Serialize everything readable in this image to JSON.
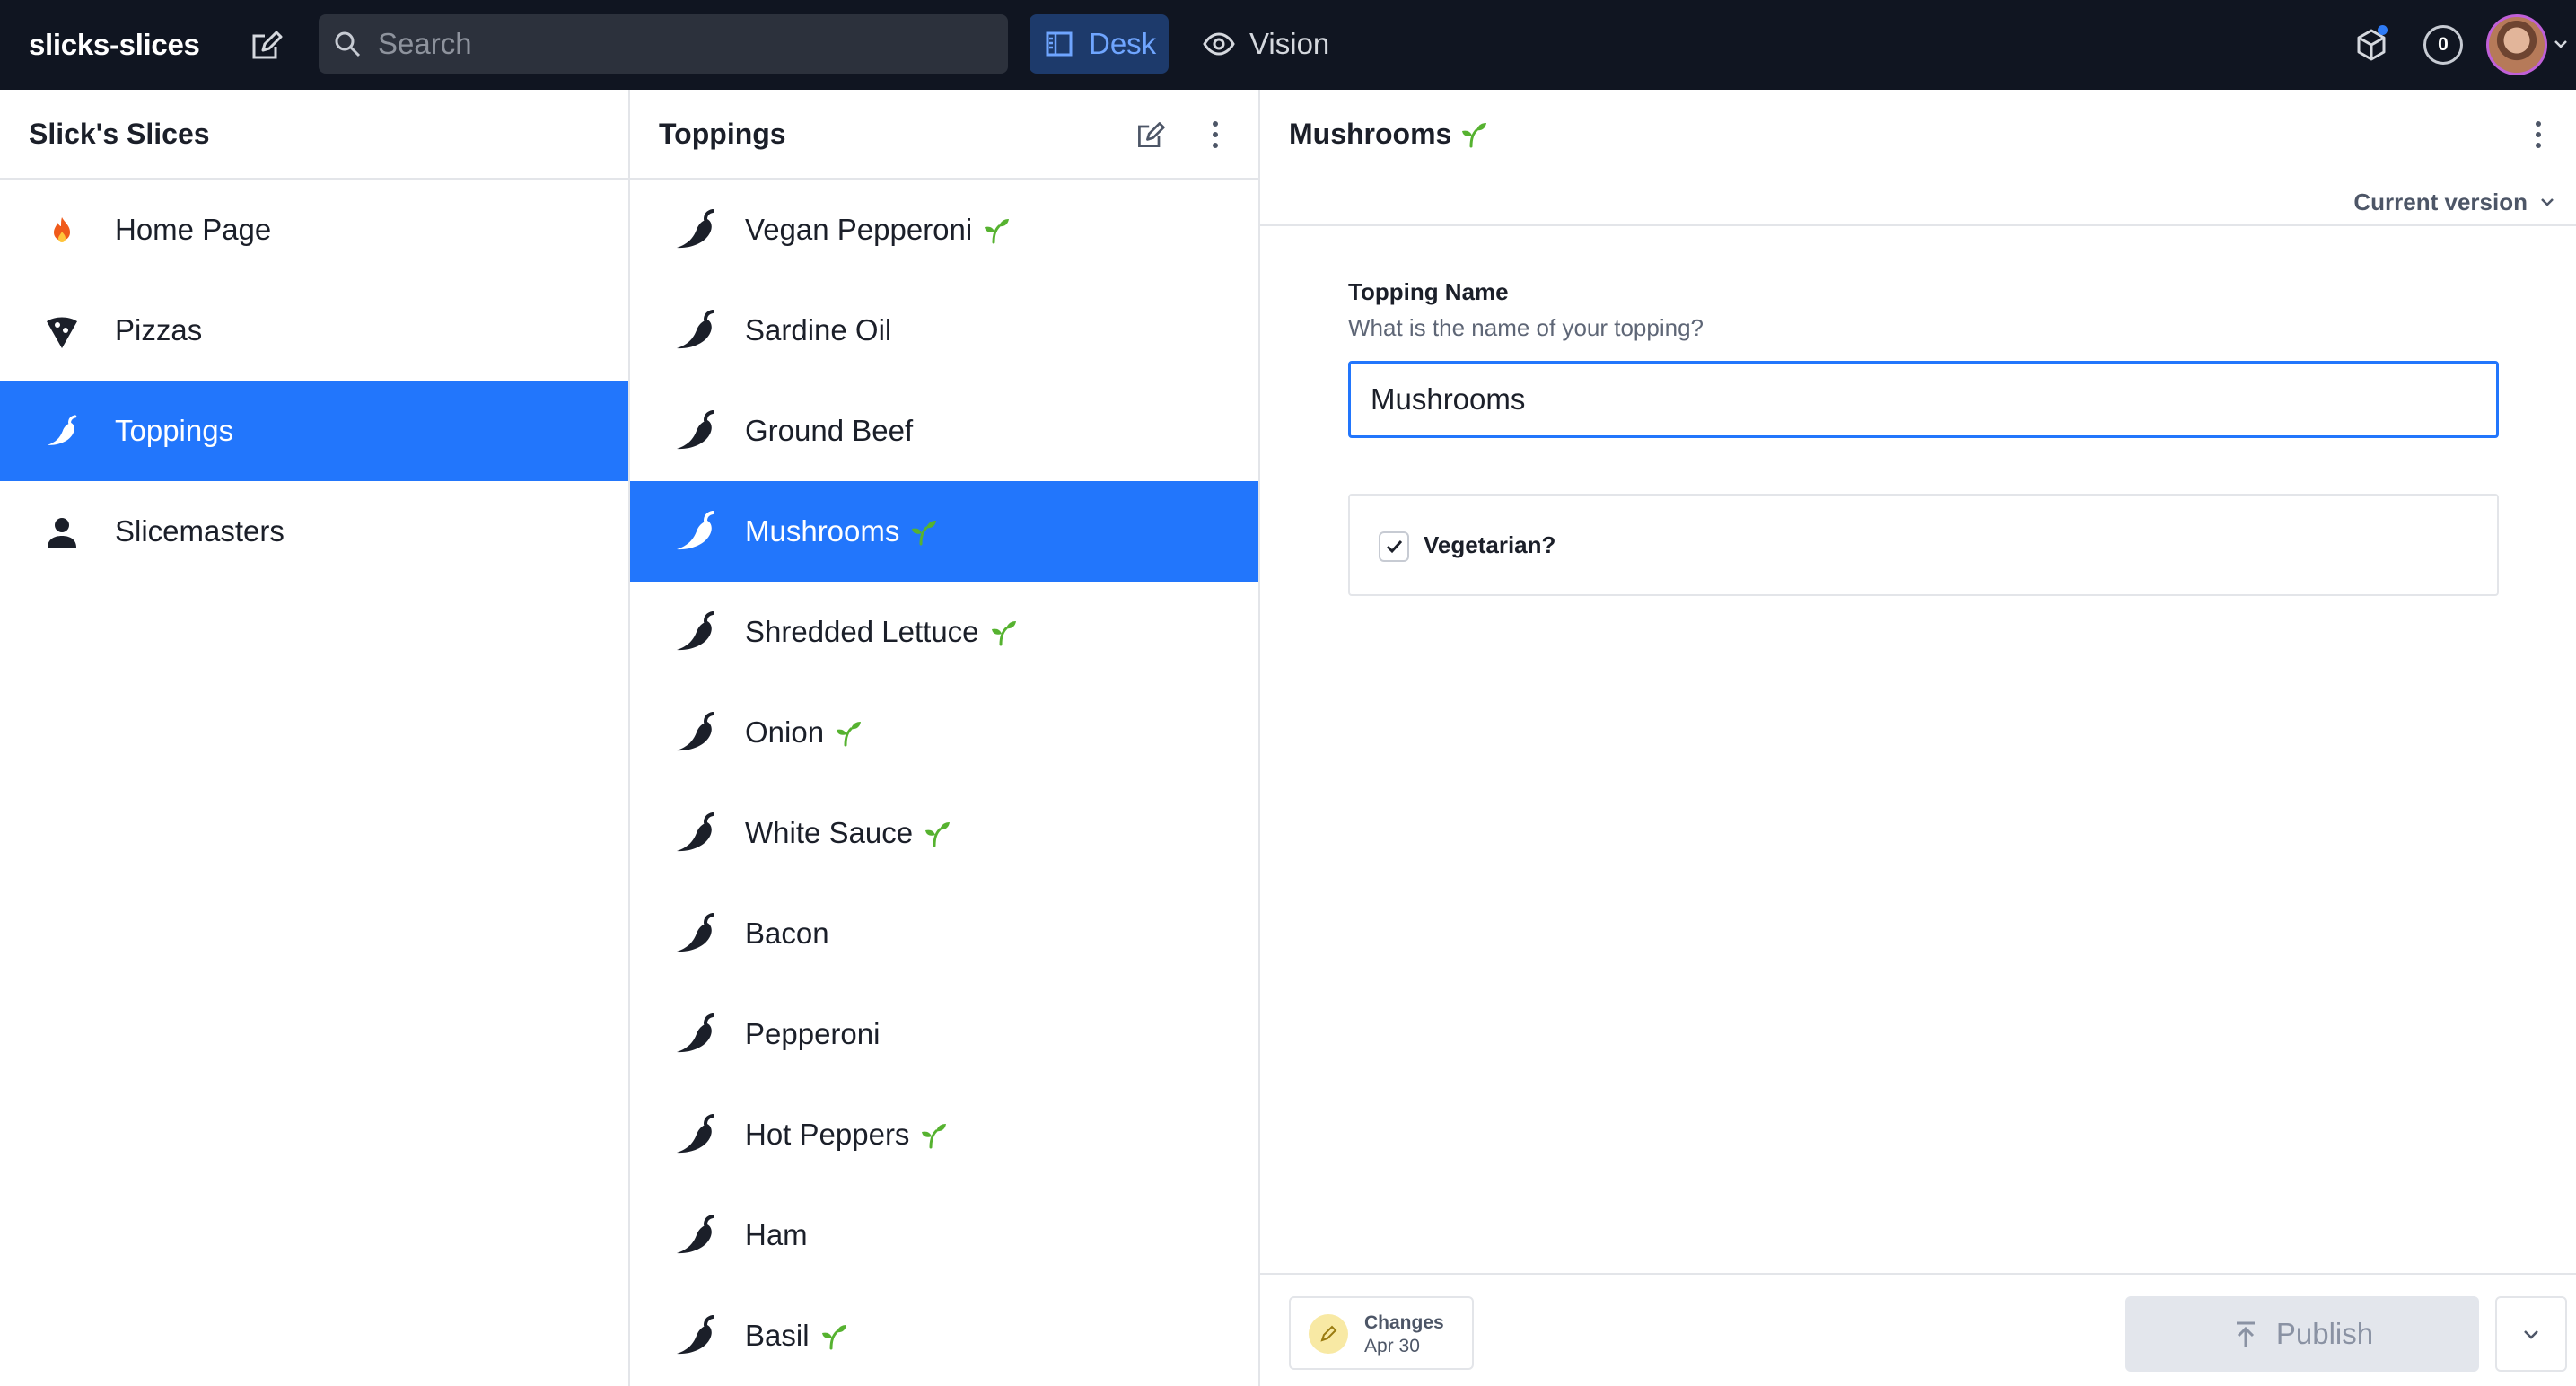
{
  "navbar": {
    "brand": "slicks-slices",
    "search_placeholder": "Search",
    "tools": [
      {
        "label": "Desk",
        "icon": "desk-icon",
        "active": true
      },
      {
        "label": "Vision",
        "icon": "eye-icon",
        "active": false
      }
    ],
    "notification_count": "0"
  },
  "pane1": {
    "title": "Slick's Slices",
    "items": [
      {
        "label": "Home Page",
        "icon": "fire-icon"
      },
      {
        "label": "Pizzas",
        "icon": "pizza-icon"
      },
      {
        "label": "Toppings",
        "icon": "pepper-icon",
        "selected": true
      },
      {
        "label": "Slicemasters",
        "icon": "person-icon"
      }
    ]
  },
  "pane2": {
    "title": "Toppings",
    "items": [
      {
        "label": "Vegan Pepperoni",
        "vegetarian": true
      },
      {
        "label": "Sardine Oil",
        "vegetarian": false
      },
      {
        "label": "Ground Beef",
        "vegetarian": false
      },
      {
        "label": "Mushrooms",
        "vegetarian": true,
        "selected": true
      },
      {
        "label": "Shredded Lettuce",
        "vegetarian": true
      },
      {
        "label": "Onion",
        "vegetarian": true
      },
      {
        "label": "White Sauce",
        "vegetarian": true
      },
      {
        "label": "Bacon",
        "vegetarian": false
      },
      {
        "label": "Pepperoni",
        "vegetarian": false
      },
      {
        "label": "Hot Peppers",
        "vegetarian": true
      },
      {
        "label": "Ham",
        "vegetarian": false
      },
      {
        "label": "Basil",
        "vegetarian": true
      }
    ]
  },
  "document": {
    "title": "Mushrooms",
    "version_label": "Current version",
    "field_label": "Topping Name",
    "field_description": "What is the name of your topping?",
    "field_value": "Mushrooms",
    "vegetarian_label": "Vegetarian?",
    "vegetarian_checked": true,
    "changes_title": "Changes",
    "changes_date": "Apr 30",
    "publish_label": "Publish"
  },
  "colors": {
    "navbar_bg": "#101521",
    "accent": "#2276fc",
    "sprout": "#56b230",
    "icon_dark": "#1b1f29"
  }
}
